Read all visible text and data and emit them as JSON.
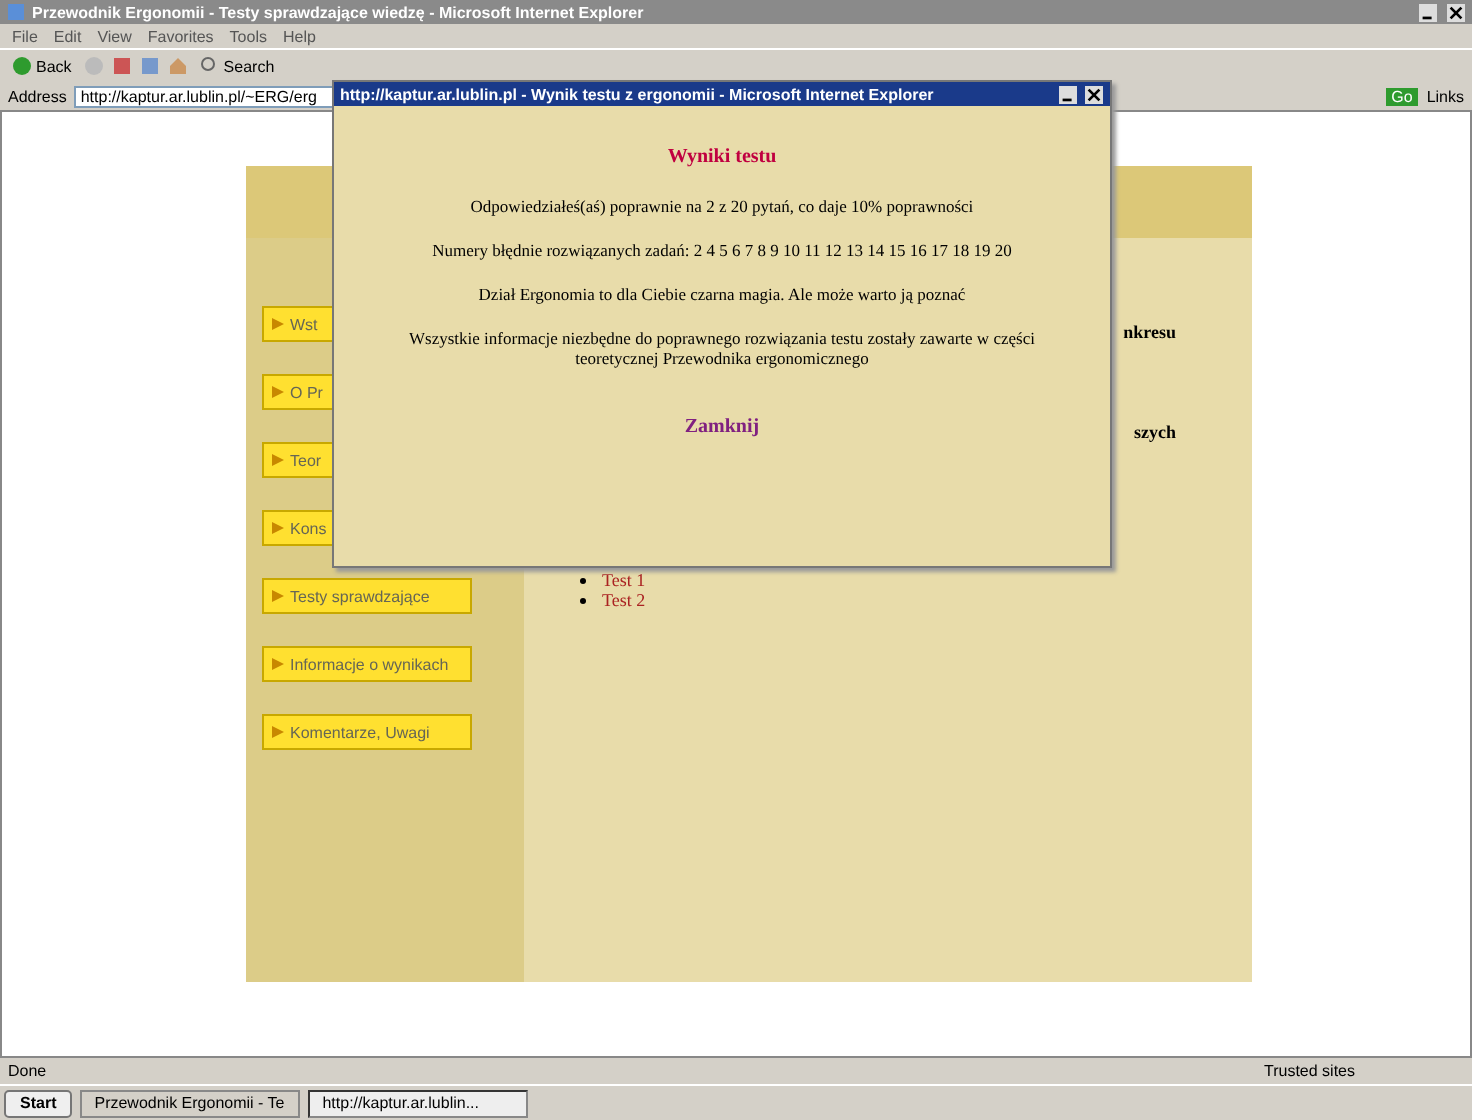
{
  "window": {
    "title": "Przewodnik Ergonomii - Testy sprawdzające wiedzę - Microsoft Internet Explorer"
  },
  "menu": [
    "File",
    "Edit",
    "View",
    "Favorites",
    "Tools",
    "Help"
  ],
  "toolbar": {
    "back": "Back",
    "search": "Search"
  },
  "address": {
    "label": "Address",
    "value": "http://kaptur.ar.lublin.pl/~ERG/erg",
    "go": "Go",
    "links": "Links"
  },
  "page": {
    "sidebar": [
      {
        "label": "Wst"
      },
      {
        "label": "O Pr"
      },
      {
        "label": "Teor"
      },
      {
        "label": "Kons"
      },
      {
        "label": "Testy sprawdzające"
      },
      {
        "label": "Informacje o wynikach"
      },
      {
        "label": "Komentarze, Uwagi"
      }
    ],
    "fragments": [
      "nkresu",
      "szych"
    ],
    "tests": [
      "Test 1",
      "Test 2"
    ]
  },
  "popup": {
    "title": "http://kaptur.ar.lublin.pl - Wynik testu z ergonomii - Microsoft Internet Explorer",
    "heading": "Wyniki testu",
    "lines": [
      "Odpowiedziałeś(aś) poprawnie na 2 z 20 pytań, co daje 10% poprawności",
      "Numery błędnie rozwiązanych zadań: 2 4 5 6 7 8 9 10 11 12 13 14 15 16 17 18 19 20",
      "Dział Ergonomia to dla Ciebie czarna magia. Ale może warto ją poznać",
      "Wszystkie informacje niezbędne do poprawnego rozwiązania testu zostały zawarte w części teoretycznej Przewodnika ergonomicznego"
    ],
    "close": "Zamknij"
  },
  "status_bar": {
    "text": "Done",
    "zone": "Trusted sites"
  },
  "taskbar": {
    "start": "Start",
    "tasks": [
      {
        "label": "Przewodnik Ergonomii - Te",
        "selected": false
      },
      {
        "label": "http://kaptur.ar.lublin...",
        "selected": true
      }
    ]
  }
}
